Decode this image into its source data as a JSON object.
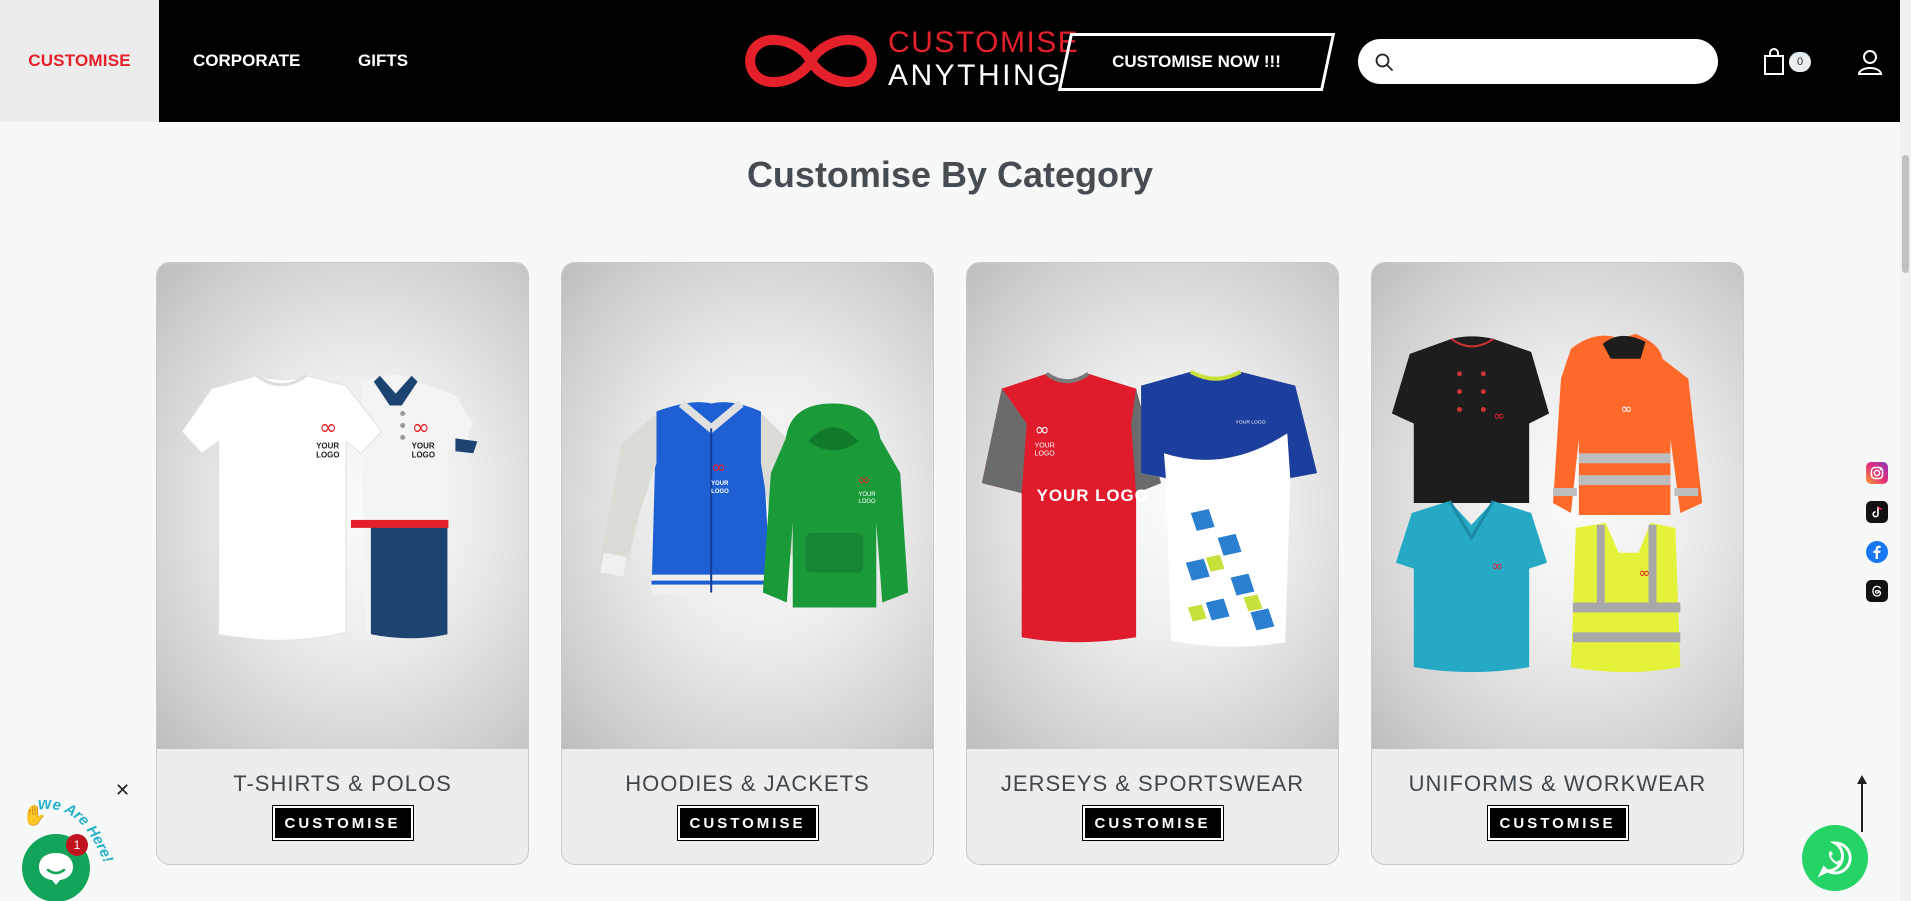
{
  "nav": {
    "items": [
      "CUSTOMISE",
      "CORPORATE",
      "GIFTS"
    ]
  },
  "logo": {
    "line1": "CUSTOMISE",
    "line2": "ANYTHING"
  },
  "cta_label": "CUSTOMISE NOW !!!",
  "search": {
    "placeholder": "",
    "value": ""
  },
  "cart": {
    "count": "0"
  },
  "section_title": "Customise By Category",
  "categories": [
    {
      "title": "T-SHIRTS & POLOS",
      "button": "CUSTOMISE"
    },
    {
      "title": "HOODIES & JACKETS",
      "button": "CUSTOMISE"
    },
    {
      "title": "JERSEYS & SPORTSWEAR",
      "button": "CUSTOMISE"
    },
    {
      "title": "UNIFORMS & WORKWEAR",
      "button": "CUSTOMISE"
    }
  ],
  "product_labels": {
    "your_logo": "YOUR LOGO"
  },
  "social": [
    "instagram-icon",
    "tiktok-icon",
    "facebook-icon",
    "threads-icon"
  ],
  "chat": {
    "badge": "1",
    "tagline": "We Are Here!",
    "close": "✕"
  },
  "colors": {
    "brand_red": "#e4202a",
    "header_bg": "#000000",
    "whatsapp_green": "#25d366",
    "chat_green": "#12a45a"
  }
}
